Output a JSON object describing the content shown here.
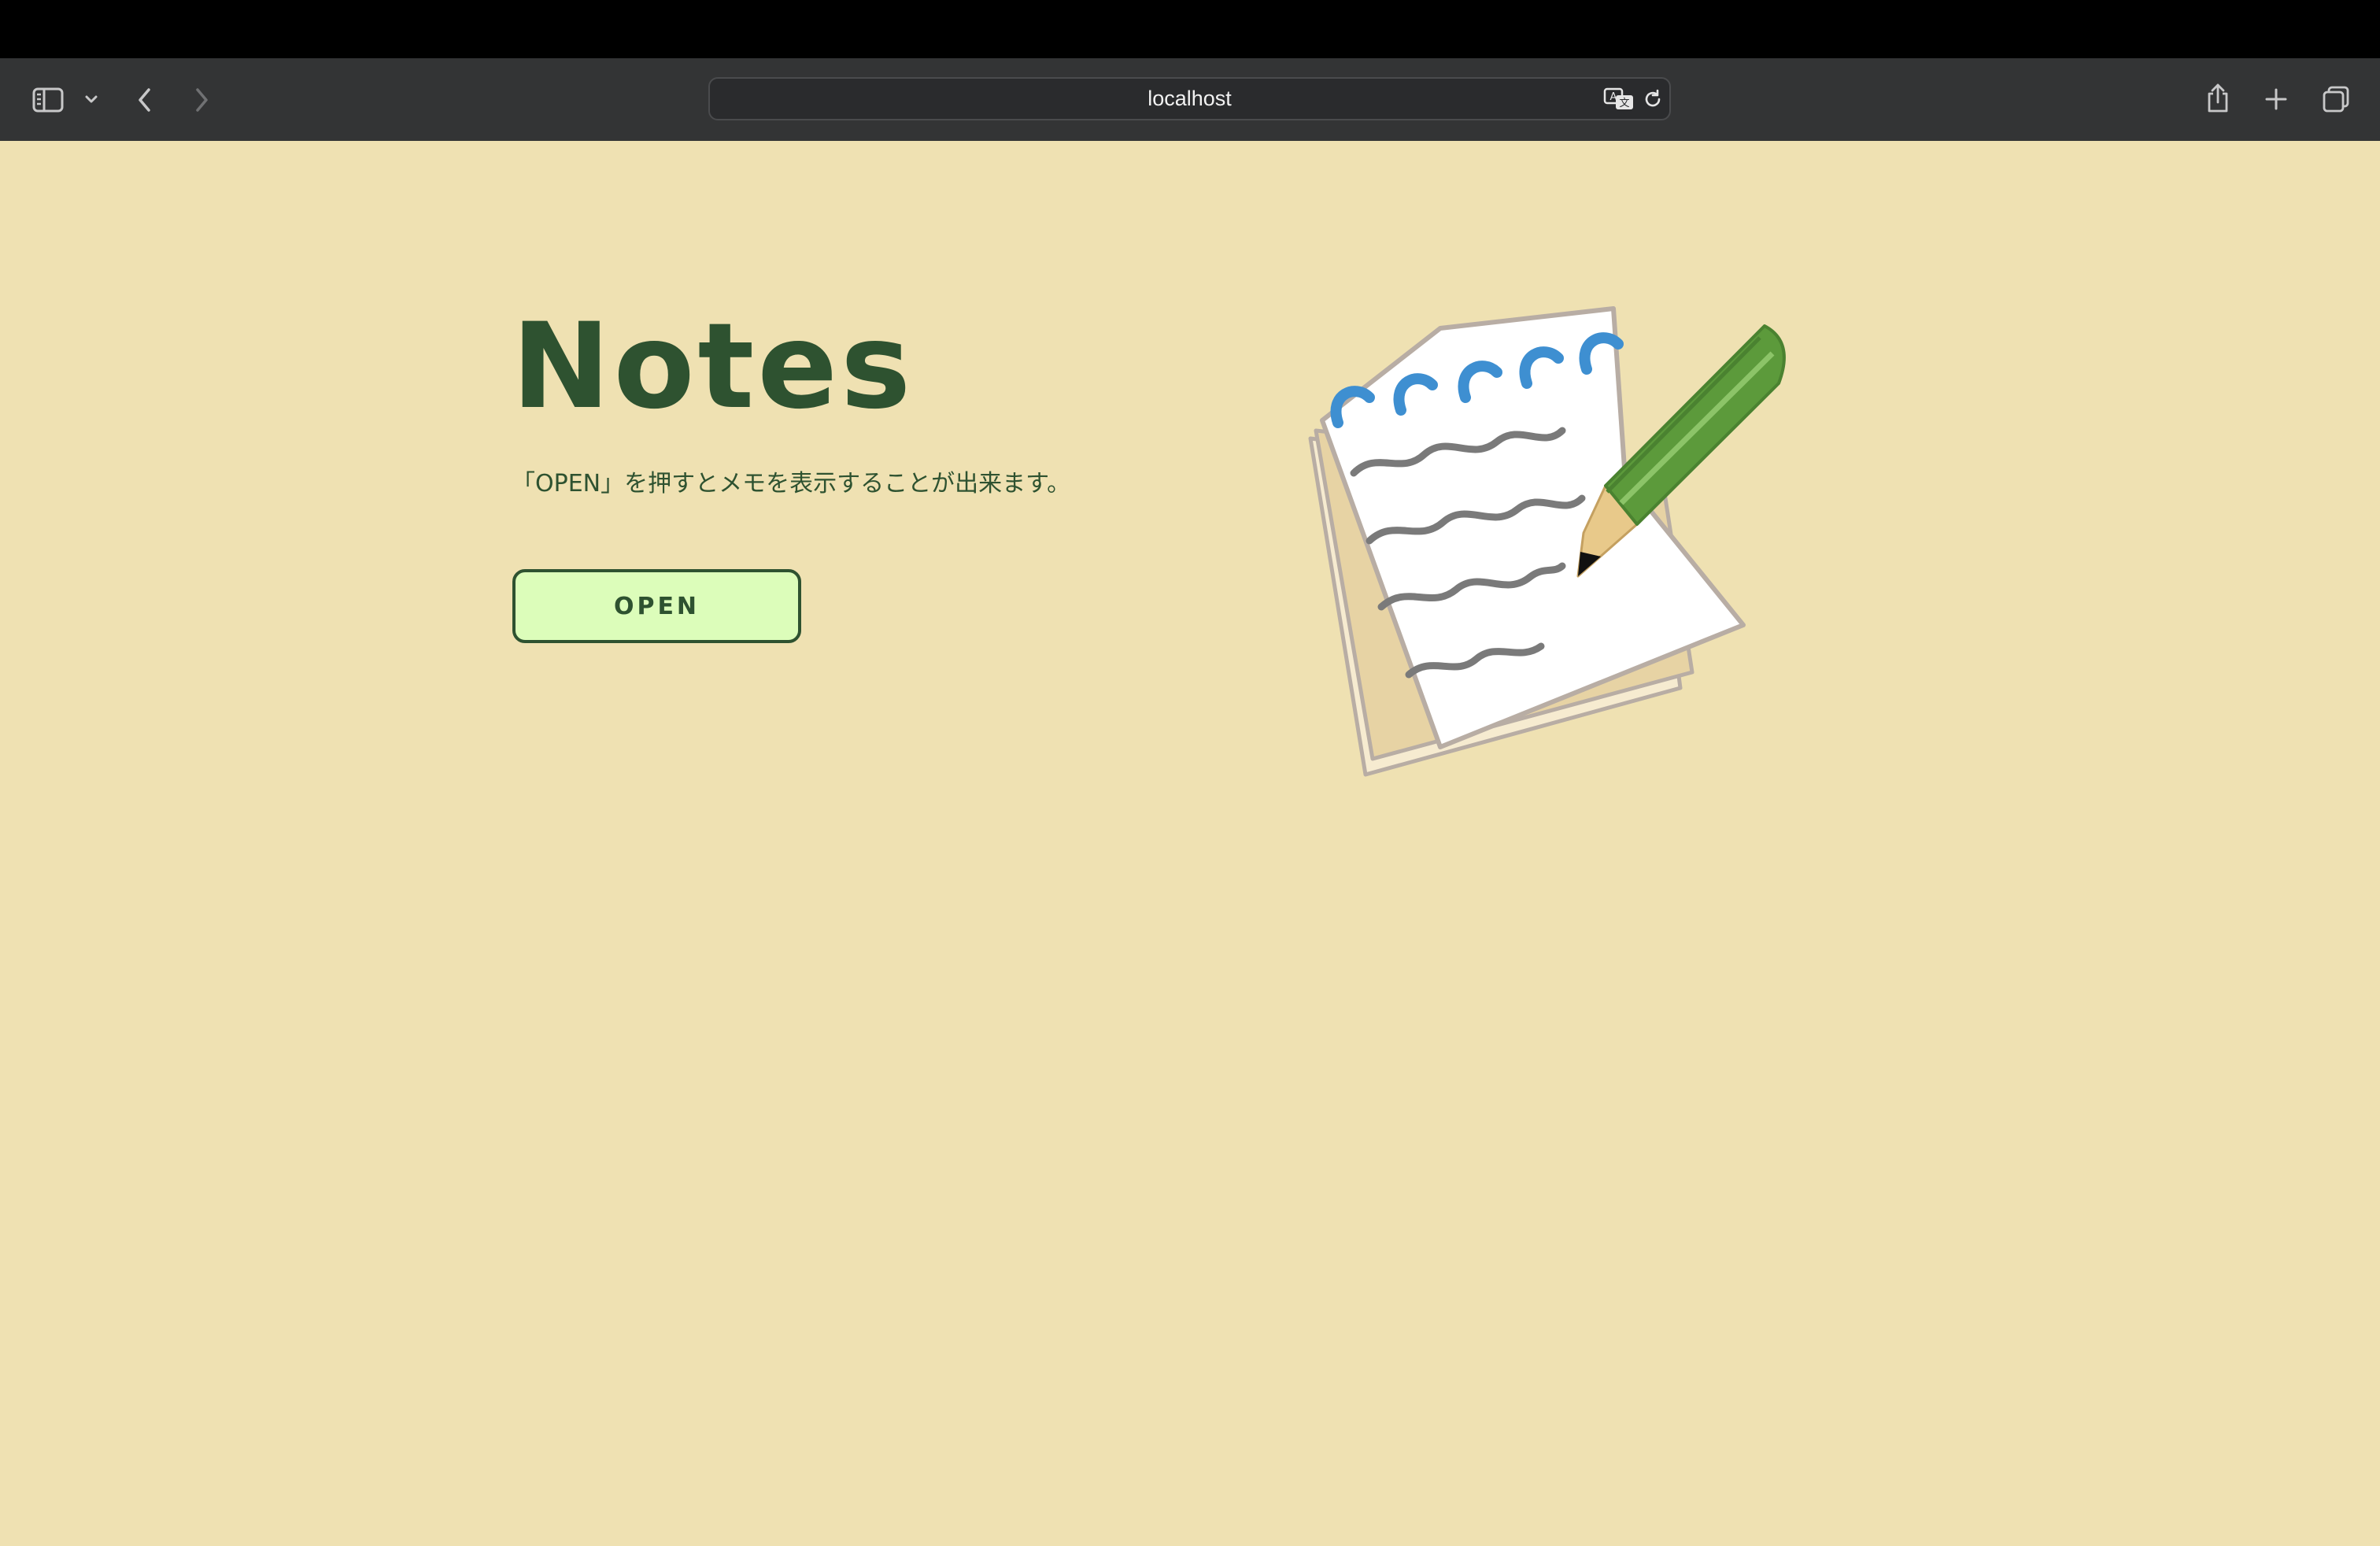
{
  "browser": {
    "url": "localhost"
  },
  "page": {
    "title": "Notes",
    "description": "「OPEN」を押すとメモを表示することが出来ます。",
    "open_button_label": "OPEN"
  },
  "icons": {
    "sidebar": "sidebar-icon",
    "sidebar_menu": "chevron-down-icon",
    "back": "chevron-left-icon",
    "forward": "chevron-right-icon",
    "translate": "translate-icon",
    "reload": "reload-icon",
    "share": "share-icon",
    "new_tab": "plus-icon",
    "tabs": "tab-overview-icon",
    "illustration": "notepad-pencil-illustration"
  },
  "colors": {
    "page_background": "#efe1b2",
    "text": "#2e5230",
    "button_fill": "#dcfdba",
    "toolbar": "#333435"
  }
}
